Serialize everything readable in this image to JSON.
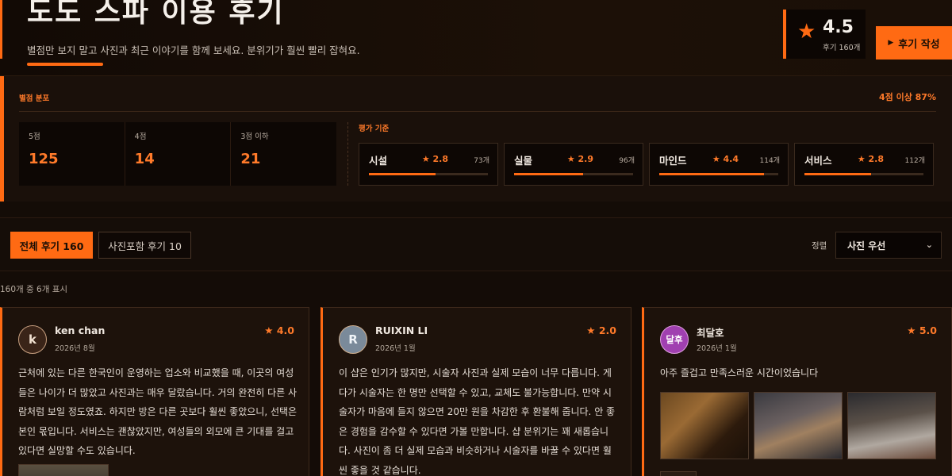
{
  "header": {
    "title": "도도 스파 이용 후기",
    "subtitle": "별점만 보지 말고 사진과 최근 이야기를 함께 보세요. 분위기가 훨씬 빨리 잡혀요.",
    "rating": "4.5",
    "rating_count": "후기 160개",
    "write_button": "후기 작성",
    "accent_color": "#ff6a13"
  },
  "distribution": {
    "label": "별점 분포",
    "summary": "4점 이상 87%",
    "scores": [
      {
        "label": "5점",
        "value": "125"
      },
      {
        "label": "4점",
        "value": "14"
      },
      {
        "label": "3점 이하",
        "value": "21"
      }
    ],
    "criteria_label": "평가 기준",
    "criteria": [
      {
        "name": "시설",
        "score": "★ 2.8",
        "count": "73개",
        "level": 0.56
      },
      {
        "name": "실물",
        "score": "★ 2.9",
        "count": "96개",
        "level": 0.58
      },
      {
        "name": "마인드",
        "score": "★ 4.4",
        "count": "114개",
        "level": 0.88
      },
      {
        "name": "서비스",
        "score": "★ 2.8",
        "count": "112개",
        "level": 0.56
      }
    ]
  },
  "tabs": {
    "all": "전체 후기 160",
    "photo": "사진포함 후기 10",
    "sort_label": "정렬",
    "sort_value": "사진 우선"
  },
  "list_count": "160개 중 6개 표시",
  "reviews": [
    {
      "initial": "k",
      "name": "ken chan",
      "date": "2026년 8월",
      "stars": "★ 4.0",
      "text": "근처에 있는 다른 한국인이 운영하는 업소와 비교했을 때, 이곳의 여성들은 나이가 더 많았고 사진과는 매우 달랐습니다. 거의 완전히 다른 사람처럼 보일 정도였죠. 하지만 방은 다른 곳보다 훨씬 좋았으니, 선택은 본인 몫입니다. 서비스는 괜찮았지만, 여성들의 외모에 큰 기대를 걸고 있다면 실망할 수도 있습니다."
    },
    {
      "initial": "R",
      "name": "RUIXIN LI",
      "date": "2026년 1월",
      "stars": "★ 2.0",
      "text": "이 샵은 인기가 많지만, 시술자 사진과 실제 모습이 너무 다릅니다. 게다가 시술자는 한 명만 선택할 수 있고, 교체도 불가능합니다. 만약 시술자가 마음에 들지 않으면 20만 원을 차감한 후 환불해 줍니다. 안 좋은 경험을 감수할 수 있다면 가볼 만합니다. 샵 분위기는 꽤 새롭습니다. 사진이 좀 더 실제 모습과 비슷하거나 시술자를 바꿀 수 있다면 훨씬 좋을 것 같습니다."
    },
    {
      "initial": "달후",
      "name": "최달호",
      "date": "2026년 1월",
      "stars": "★ 5.0",
      "text": "아주 즐겁고 만족스러운 시간이었습니다"
    }
  ]
}
